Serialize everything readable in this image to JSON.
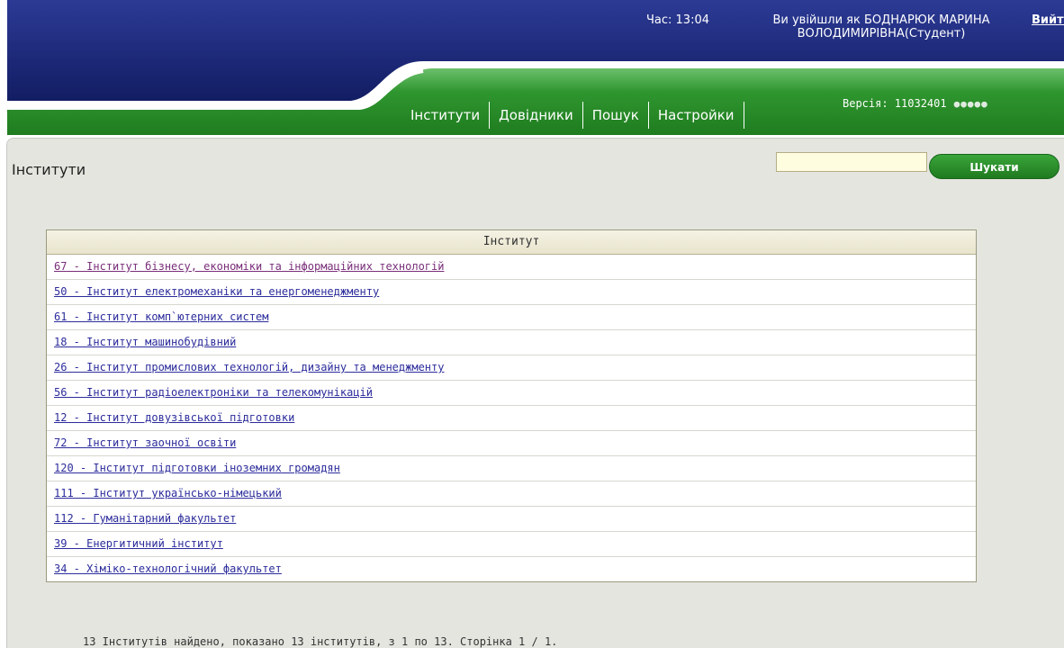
{
  "header": {
    "time_label": "Час: 13:04",
    "user_label": "Ви увійшли як БОДНАРЮК МАРИНА ВОЛОДИМИРІВНА(Студент)",
    "logout_label": "Вийти",
    "nav": [
      {
        "label": "Інститути"
      },
      {
        "label": "Довідники"
      },
      {
        "label": "Пошук"
      },
      {
        "label": "Настройки"
      }
    ],
    "version_label": "Версія: 11032401",
    "dots": "●●●●●"
  },
  "colors": {
    "header_blue": "#1a2a7c",
    "header_green": "#2e8b2e",
    "panel_bg": "#e5e5e0",
    "link": "#2c2c9c"
  },
  "page": {
    "title": "Інститути",
    "search_value": "",
    "search_button": "Шукати"
  },
  "table": {
    "header": "Інститут",
    "rows": [
      {
        "label": "67 - Інститут бізнесу, економіки та інформаційних технологій"
      },
      {
        "label": "50 - Інститут електромеханіки та енергоменеджменту"
      },
      {
        "label": "61 - Інститут комп`ютерних систем"
      },
      {
        "label": "18 - Інститут машинобудівний"
      },
      {
        "label": "26 - Інститут промислових технологій, дизайну та менеджменту"
      },
      {
        "label": "56 - Інститут радіоелектроніки та телекомунікацій"
      },
      {
        "label": "12 - Інститут довузівської підготовки"
      },
      {
        "label": "72 - Інститут заочної освіти"
      },
      {
        "label": "120 - Інститут підготовки іноземних громадян"
      },
      {
        "label": "111 - Інститут українсько-німецький"
      },
      {
        "label": "112 - Гуманітарний факультет"
      },
      {
        "label": "39 - Енергитичний інститут"
      },
      {
        "label": "34 - Хіміко-технологічний факультет"
      }
    ]
  },
  "footer": {
    "summary": "13 Інститутів найдено, показано 13 інститутів, з 1 по 13. Сторінка 1 / 1."
  }
}
